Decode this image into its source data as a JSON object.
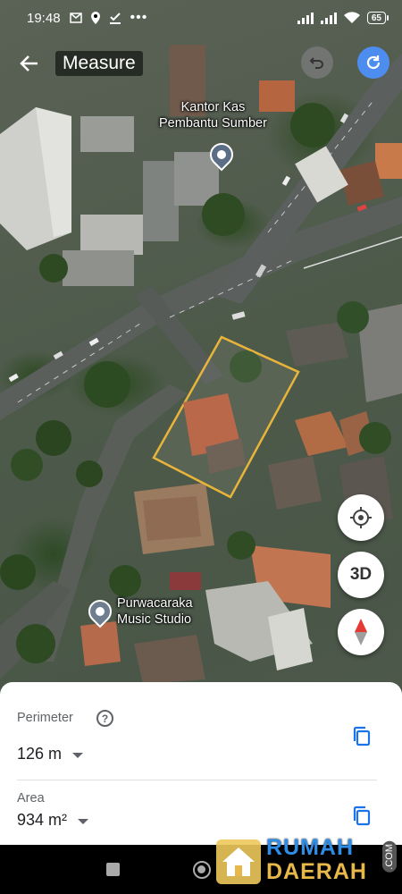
{
  "status_bar": {
    "time": "19:48",
    "battery": "65"
  },
  "app_bar": {
    "title": "Measure"
  },
  "map": {
    "labels": {
      "kantor_line1": "Kantor Kas",
      "kantor_line2": "Pembantu Sumber",
      "purwa_line1": "Purwacaraka",
      "purwa_line2": "Music Studio"
    },
    "controls": {
      "three_d": "3D"
    },
    "polygon_color": "#e8b43a"
  },
  "sheet": {
    "perimeter_label": "Perimeter",
    "perimeter_value": "126 m",
    "area_label": "Area",
    "area_value": "934 m²",
    "accent_color": "#1a73e8"
  },
  "watermark": {
    "line1": "RUMAH",
    "line2": "DAERAH",
    "suffix": ".COM"
  },
  "icons": [
    "back-arrow-icon",
    "undo-icon",
    "redo-icon",
    "help-icon",
    "copy-icon",
    "my-location-icon",
    "compass-icon",
    "pin-icon"
  ]
}
